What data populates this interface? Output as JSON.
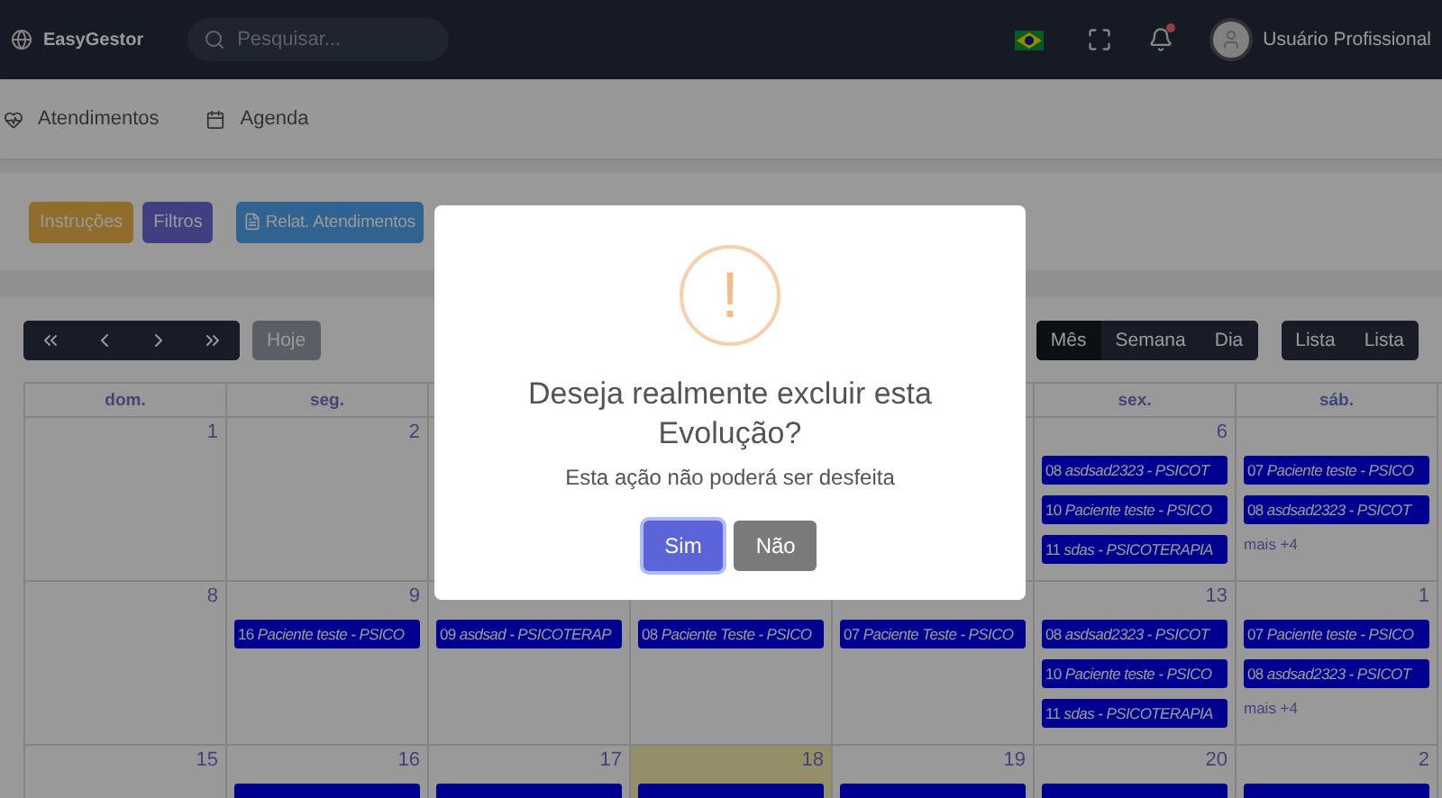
{
  "topbar": {
    "brand": "EasyGestor",
    "search": {
      "placeholder": "Pesquisar..."
    },
    "notifications": {
      "unread": true
    },
    "user": {
      "name": "Usuário Profissional"
    }
  },
  "nav": [
    {
      "kind": "heart",
      "label": "Atendimentos"
    },
    {
      "kind": "calendar",
      "label": "Agenda"
    }
  ],
  "actions": [
    {
      "kind": "warning",
      "label": "Instruções"
    },
    {
      "kind": "primary",
      "label": "Filtros"
    },
    {
      "kind": "report",
      "label": "Relat. Atendimentos"
    }
  ],
  "calendar": {
    "today_button": {
      "label": "Hoje",
      "disabled": true
    },
    "views": [
      {
        "label": "Mês",
        "selected": true
      },
      {
        "label": "Semana",
        "selected": false
      },
      {
        "label": "Dia",
        "selected": false
      }
    ],
    "list_views": [
      {
        "label": "Lista"
      },
      {
        "label": "Lista"
      }
    ],
    "weekdays_before_modal": [
      {
        "label": "dom."
      },
      {
        "label": "seg."
      }
    ],
    "weekdays_after_modal": [
      {
        "label": "sex."
      },
      {
        "label": "sáb."
      }
    ],
    "weeks": [
      {
        "days_before_modal": [
          {
            "date": "1",
            "today": false
          },
          {
            "date": "2",
            "today": false
          }
        ],
        "days_after_modal": [
          {
            "date": "6",
            "today": false,
            "events": [
              {
                "kind": "text",
                "text": "08 *asdsad2323 - PSICOT*"
              },
              {
                "kind": "text",
                "text": "10 *Paciente teste - PSICO*"
              },
              {
                "kind": "text",
                "text": "11 *sdas - PSICOTERAPIA*"
              }
            ]
          },
          {
            "today": false,
            "events": [
              {
                "kind": "text",
                "text": "07 *Paciente teste - PSICO*"
              },
              {
                "kind": "text",
                "text": "08 *asdsad2323 - PSICOT*"
              }
            ],
            "more": "mais +4"
          }
        ]
      },
      {
        "days": [
          {
            "date": "8",
            "today": false
          },
          {
            "date": "9",
            "today": false,
            "events": [
              {
                "kind": "text",
                "text": "16 *Paciente teste - PSICO*"
              }
            ]
          },
          {
            "today": false,
            "events": [
              {
                "kind": "text",
                "text": "09 *asdsad - PSICOTERAP*"
              }
            ]
          },
          {
            "today": false,
            "events": [
              {
                "kind": "text",
                "text": "08 *Paciente Teste - PSICO*"
              }
            ]
          },
          {
            "today": false,
            "events": [
              {
                "kind": "text",
                "text": "07 *Paciente Teste - PSICO*"
              }
            ]
          },
          {
            "date": "13",
            "today": false,
            "events": [
              {
                "kind": "text",
                "text": "08 *asdsad2323 - PSICOT*"
              },
              {
                "kind": "text",
                "text": "10 *Paciente teste - PSICO*"
              },
              {
                "kind": "text",
                "text": "11 *sdas - PSICOTERAPIA*"
              }
            ]
          },
          {
            "date": "1",
            "today": false,
            "events": [
              {
                "kind": "text",
                "text": "07 *Paciente teste - PSICO*"
              },
              {
                "kind": "text",
                "text": "08 *asdsad2323 - PSICOT*"
              }
            ],
            "more": "mais +4"
          }
        ]
      },
      {
        "days": [
          {
            "date": "15",
            "today": false
          },
          {
            "date": "16",
            "today": false,
            "events": [
              {
                "kind": "bar"
              }
            ]
          },
          {
            "date": "17",
            "today": false,
            "events": [
              {
                "kind": "bar"
              }
            ]
          },
          {
            "date": "18",
            "today": true,
            "events": [
              {
                "kind": "bar"
              }
            ]
          },
          {
            "date": "19",
            "today": false,
            "events": [
              {
                "kind": "bar"
              }
            ]
          },
          {
            "date": "20",
            "today": false,
            "events": [
              {
                "kind": "bar"
              }
            ]
          },
          {
            "date": "2",
            "today": false,
            "events": [
              {
                "kind": "bar"
              }
            ]
          }
        ]
      }
    ]
  },
  "modal": {
    "icon": "!",
    "title": "Deseja realmente excluir esta Evolução?",
    "text": "Esta ação não poderá ser desfeita",
    "buttons": [
      {
        "kind": "confirm",
        "label": "Sim",
        "focused": true
      },
      {
        "kind": "cancel",
        "label": "Não",
        "focused": false
      }
    ]
  }
}
